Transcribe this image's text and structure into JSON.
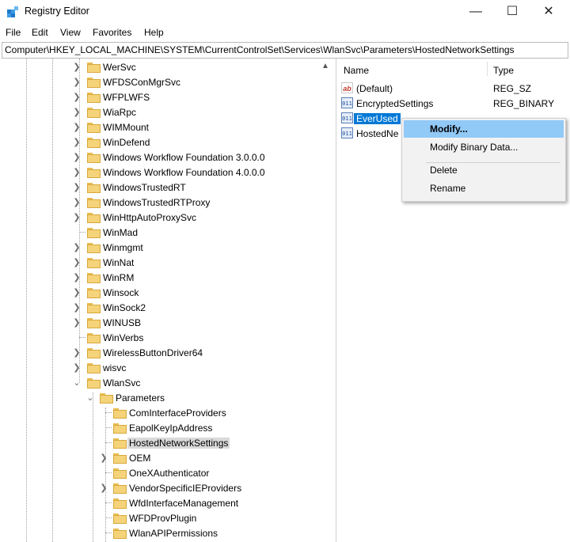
{
  "window": {
    "title": "Registry Editor"
  },
  "menu": [
    "File",
    "Edit",
    "View",
    "Favorites",
    "Help"
  ],
  "address": "Computer\\HKEY_LOCAL_MACHINE\\SYSTEM\\CurrentControlSet\\Services\\WlanSvc\\Parameters\\HostedNetworkSettings",
  "tree": [
    {
      "label": "WerSvc"
    },
    {
      "label": "WFDSConMgrSvc"
    },
    {
      "label": "WFPLWFS"
    },
    {
      "label": "WiaRpc"
    },
    {
      "label": "WIMMount"
    },
    {
      "label": "WinDefend"
    },
    {
      "label": "Windows Workflow Foundation 3.0.0.0"
    },
    {
      "label": "Windows Workflow Foundation 4.0.0.0"
    },
    {
      "label": "WindowsTrustedRT"
    },
    {
      "label": "WindowsTrustedRTProxy"
    },
    {
      "label": "WinHttpAutoProxySvc"
    },
    {
      "label": "WinMad"
    },
    {
      "label": "Winmgmt"
    },
    {
      "label": "WinNat"
    },
    {
      "label": "WinRM"
    },
    {
      "label": "Winsock"
    },
    {
      "label": "WinSock2"
    },
    {
      "label": "WINUSB"
    },
    {
      "label": "WinVerbs"
    },
    {
      "label": "WirelessButtonDriver64"
    },
    {
      "label": "wisvc"
    },
    {
      "label": "WlanSvc"
    },
    {
      "label": "Parameters"
    },
    {
      "label": "ComInterfaceProviders"
    },
    {
      "label": "EapolKeyIpAddress"
    },
    {
      "label": "HostedNetworkSettings"
    },
    {
      "label": "OEM"
    },
    {
      "label": "OneXAuthenticator"
    },
    {
      "label": "VendorSpecificIEProviders"
    },
    {
      "label": "WfdInterfaceManagement"
    },
    {
      "label": "WFDProvPlugin"
    },
    {
      "label": "WlanAPIPermissions"
    }
  ],
  "list": {
    "columns": {
      "name": "Name",
      "type": "Type"
    },
    "values": [
      {
        "name": "(Default)",
        "type": "REG_SZ",
        "icon": "string-value-icon"
      },
      {
        "name": "EncryptedSettings",
        "type": "REG_BINARY",
        "icon": "binary-value-icon"
      },
      {
        "name": "EverUsed",
        "type": "",
        "icon": "binary-value-icon"
      },
      {
        "name": "HostedNe",
        "type": "",
        "icon": "binary-value-icon"
      }
    ]
  },
  "context_menu": {
    "items": [
      "Modify...",
      "Modify Binary Data...",
      "Delete",
      "Rename"
    ]
  },
  "colors": {
    "selection": "#0078d7",
    "menu_highlight": "#91c9f7",
    "folder": "#f5d37a"
  }
}
